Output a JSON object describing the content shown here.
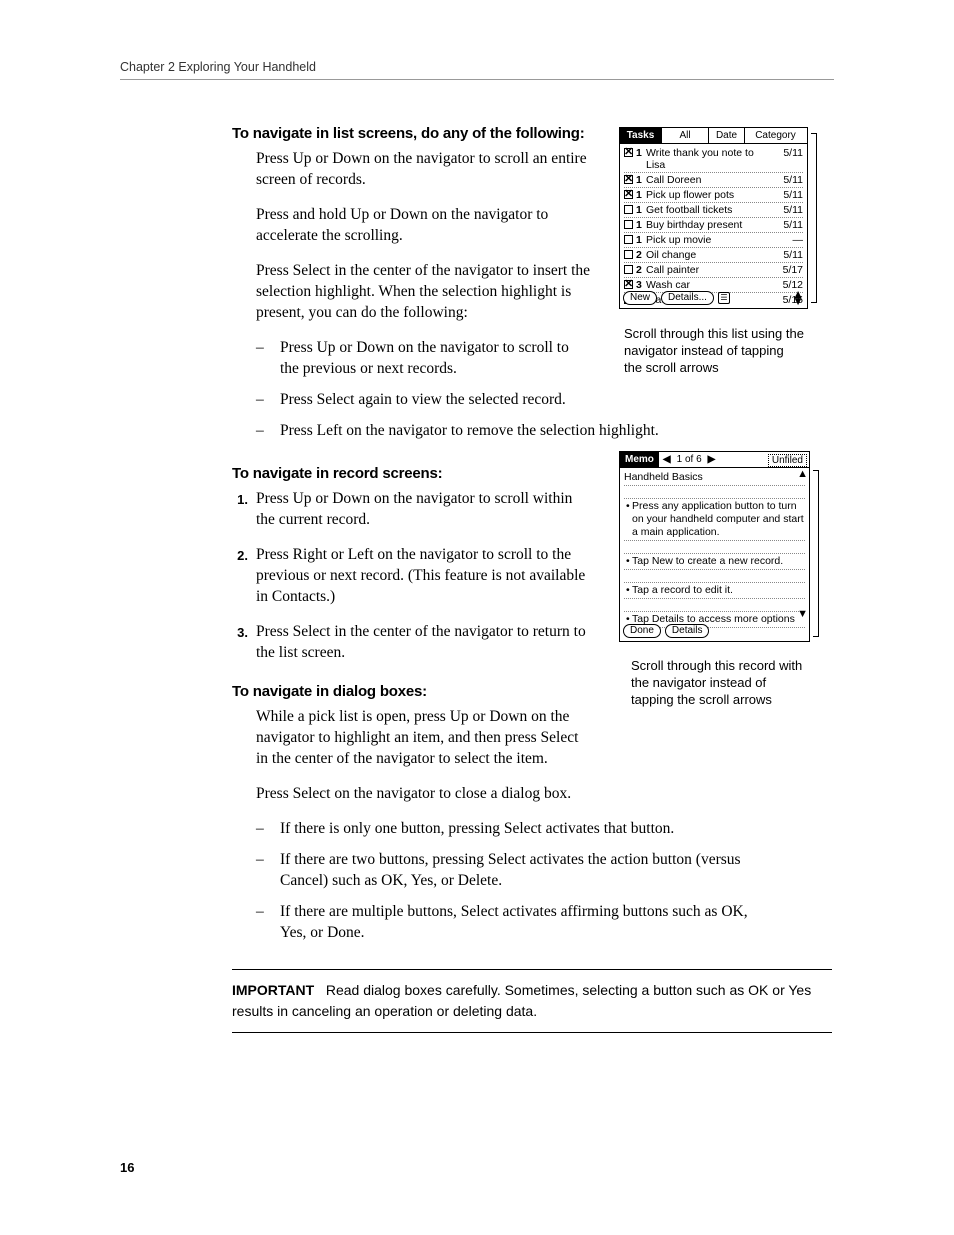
{
  "running_head": "Chapter 2   Exploring Your Handheld",
  "page_number": "16",
  "sect1": {
    "heading": "To navigate in list screens, do any of the following:",
    "p1": "Press Up or Down on the navigator to scroll an entire screen of records.",
    "p2": "Press and hold Up or Down on the navigator to accelerate the scrolling.",
    "p3": "Press Select in the center of the navigator to insert the selection highlight. When the selection highlight is present, you can do the following:",
    "bullets": [
      "Press Up or Down on the navigator to scroll to the previous or next records.",
      "Press Select again to view the selected record.",
      "Press Left on the navigator to remove the selection highlight."
    ]
  },
  "sect2": {
    "heading": "To navigate in record screens:",
    "items": [
      "Press Up or Down on the navigator to scroll within the current record.",
      "Press Right or Left on the navigator to scroll to the previous or next record. (This feature is not available in Contacts.)",
      "Press Select in the center of the navigator to return to the list screen."
    ]
  },
  "sect3": {
    "heading": "To navigate in dialog boxes:",
    "p1": "While a pick list is open, press Up or Down on the navigator to highlight an item, and then press Select in the center of the navigator to select the item.",
    "p2": "Press Select on the navigator to close a dialog box.",
    "bullets": [
      "If there is only one button, pressing Select activates that button.",
      "If there are two buttons, pressing Select activates the action button (versus Cancel) such as OK, Yes, or Delete.",
      "If there are multiple buttons, Select activates affirming buttons such as OK, Yes, or Done."
    ]
  },
  "important": {
    "label": "IMPORTANT",
    "text": "Read dialog boxes carefully. Sometimes, selecting a button such as OK or Yes results in canceling an operation or deleting data."
  },
  "tasks_shot": {
    "head_tasks": "Tasks",
    "head_all": "All",
    "head_date": "Date",
    "head_category": "Category",
    "rows": [
      {
        "checked": true,
        "pri": "1",
        "text": "Write thank you note to Lisa",
        "date": "5/11"
      },
      {
        "checked": true,
        "pri": "1",
        "text": "Call Doreen",
        "date": "5/11"
      },
      {
        "checked": true,
        "pri": "1",
        "text": "Pick up flower pots",
        "date": "5/11"
      },
      {
        "checked": false,
        "pri": "1",
        "text": "Get football tickets",
        "date": "5/11"
      },
      {
        "checked": false,
        "pri": "1",
        "text": "Buy birthday present",
        "date": "5/11"
      },
      {
        "checked": false,
        "pri": "1",
        "text": "Pick up movie",
        "date": "—"
      },
      {
        "checked": false,
        "pri": "2",
        "text": "Oil change",
        "date": "5/11"
      },
      {
        "checked": false,
        "pri": "2",
        "text": "Call painter",
        "date": "5/17"
      },
      {
        "checked": true,
        "pri": "3",
        "text": "Wash car",
        "date": "5/12"
      },
      {
        "checked": true,
        "pri": "3",
        "text": "Water lawn",
        "date": "5/15"
      }
    ],
    "btn_new": "New",
    "btn_details": "Details...",
    "caption": "Scroll through this list using the navigator instead of tapping the scroll arrows"
  },
  "memo_shot": {
    "head_title": "Memo",
    "head_count": "1 of 6",
    "head_category": "Unfiled",
    "title": "Handheld Basics",
    "lines": [
      "Press any application button to turn on your handheld computer and start a main application.",
      "Tap New to create a new record.",
      "Tap a record to edit it.",
      "Tap Details to access more options"
    ],
    "btn_done": "Done",
    "btn_details": "Details",
    "caption": "Scroll through this record with the navigator instead of tapping the scroll arrows"
  }
}
